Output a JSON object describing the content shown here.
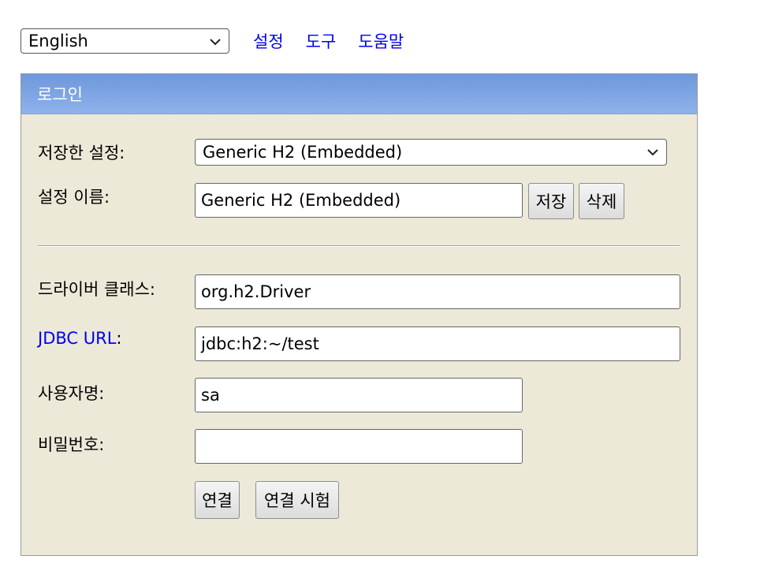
{
  "topbar": {
    "language_selected": "English",
    "links": [
      "설정",
      "도구",
      "도움말"
    ]
  },
  "login": {
    "title": "로그인",
    "saved_settings_label": "저장한 설정:",
    "saved_settings_value": "Generic H2 (Embedded)",
    "setting_name_label": "설정 이름:",
    "setting_name_value": "Generic H2 (Embedded)",
    "save_button": "저장",
    "delete_button": "삭제",
    "driver_class_label": "드라이버 클래스:",
    "driver_class_value": "org.h2.Driver",
    "jdbc_url_label": "JDBC URL",
    "jdbc_url_colon": ":",
    "jdbc_url_value": "jdbc:h2:~/test",
    "username_label": "사용자명:",
    "username_value": "sa",
    "password_label": "비밀번호:",
    "password_value": "",
    "connect_button": "연결",
    "test_connection_button": "연결 시험"
  },
  "icons": {
    "dropdown": "chevron-down-icon"
  },
  "colors": {
    "header_gradient_top": "#6d98dd",
    "header_gradient_bottom": "#8fb2ea",
    "panel_background": "#ece9d8",
    "link": "#0000ee"
  }
}
